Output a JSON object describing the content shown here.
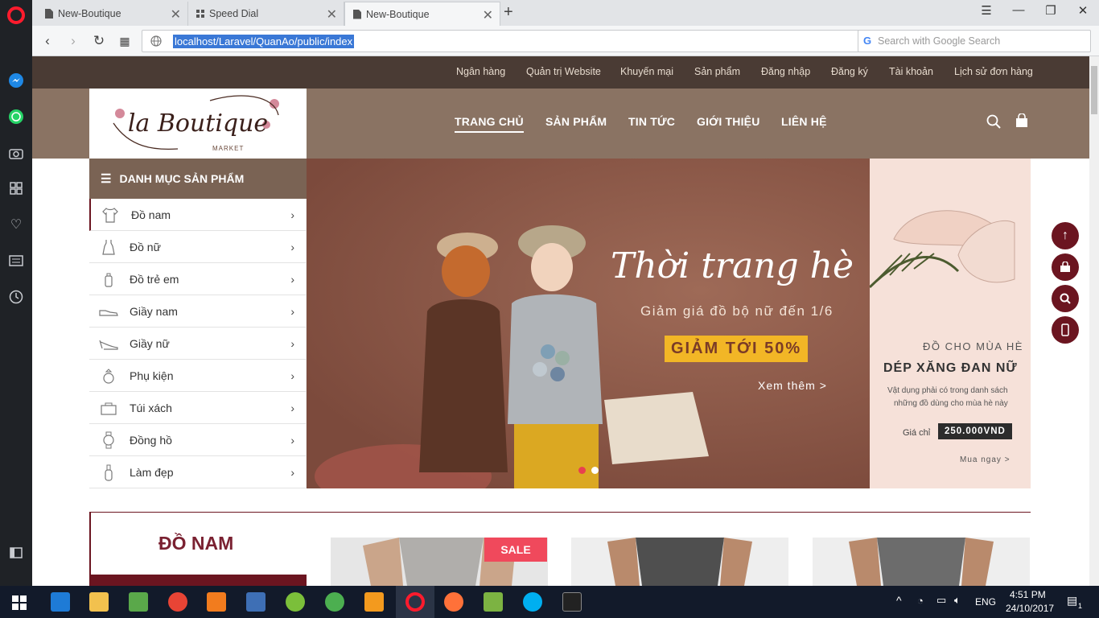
{
  "browser": {
    "tabs": [
      {
        "label": "New-Boutique",
        "icon": "doc-icon"
      },
      {
        "label": "Speed Dial",
        "icon": "grid-icon"
      },
      {
        "label": "New-Boutique",
        "icon": "doc-icon",
        "active": true
      }
    ],
    "new_tab": "+",
    "url": "localhost/Laravel/QuanAo/public/index",
    "search_placeholder": "Search with Google Search"
  },
  "site": {
    "top_links": [
      "Ngân hàng",
      "Quản trị Website",
      "Khuyến mại",
      "Sản phẩm",
      "Đăng nhập",
      "Đăng ký",
      "Tài khoản",
      "Lịch sử đơn hàng"
    ],
    "logo": {
      "script": "la Boutique",
      "sub": "MARKET"
    },
    "main_nav": [
      "TRANG CHỦ",
      "SẢN PHẨM",
      "TIN TỨC",
      "GIỚI THIỆU",
      "LIÊN HỆ"
    ],
    "category_title": "DANH MỤC SẢN PHẨM",
    "categories": [
      "Đồ nam",
      "Đồ nữ",
      "Đồ trẻ em",
      "Giầy nam",
      "Giầy nữ",
      "Phụ kiện",
      "Túi xách",
      "Đồng hồ",
      "Làm đẹp"
    ],
    "banner": {
      "headline": "Thời trang hè",
      "sub": "Giảm giá đồ bộ nữ đến 1/6",
      "promo": "GIẢM TỚI 50%",
      "more": "Xem thêm >"
    },
    "side_banner": {
      "kicker": "ĐỒ CHO MÙA HÈ",
      "title": "DÉP XĂNG ĐAN NỮ",
      "desc1": "Vật dụng phải có trong danh sách",
      "desc2": "những đồ dùng cho mùa hè này",
      "price_label": "Giá chỉ",
      "price": "250.000VND",
      "cta": "Mua ngay >"
    },
    "section_title": "ĐỒ NAM",
    "sale_badge": "SALE"
  },
  "taskbar": {
    "lang": "ENG",
    "time": "4:51 PM",
    "date": "24/10/2017",
    "notif_count": "1"
  },
  "colors": {
    "topbar": "#4a3b34",
    "header": "#8a7363",
    "accent": "#6b1520",
    "promo_yellow": "#f2b626"
  }
}
